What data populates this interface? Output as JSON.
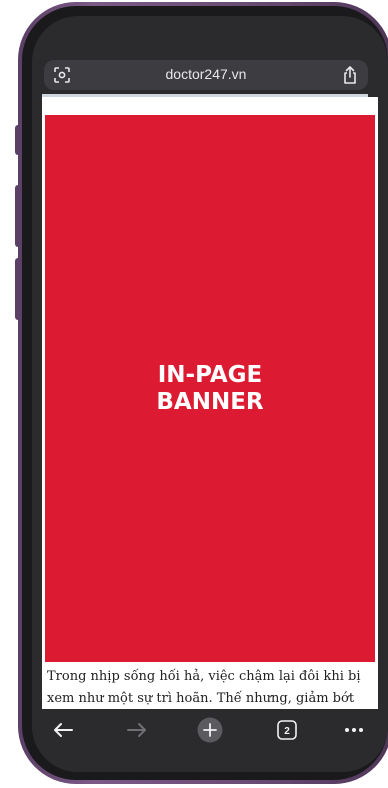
{
  "browser": {
    "url": "doctor247.vn",
    "tab_count": "2"
  },
  "page": {
    "banner_text": "IN-PAGE BANNER",
    "article_text": "Trong nhịp sống hối hả, việc chậm lại đôi khi bị xem như một sự trì hoãn. Thế nhưng, giảm bớt",
    "banner_color": "#dc1a31"
  },
  "toolbar": {
    "icons": [
      "back-arrow-icon",
      "forward-arrow-icon",
      "new-tab-plus-icon",
      "tab-switcher-icon",
      "more-options-icon"
    ]
  }
}
